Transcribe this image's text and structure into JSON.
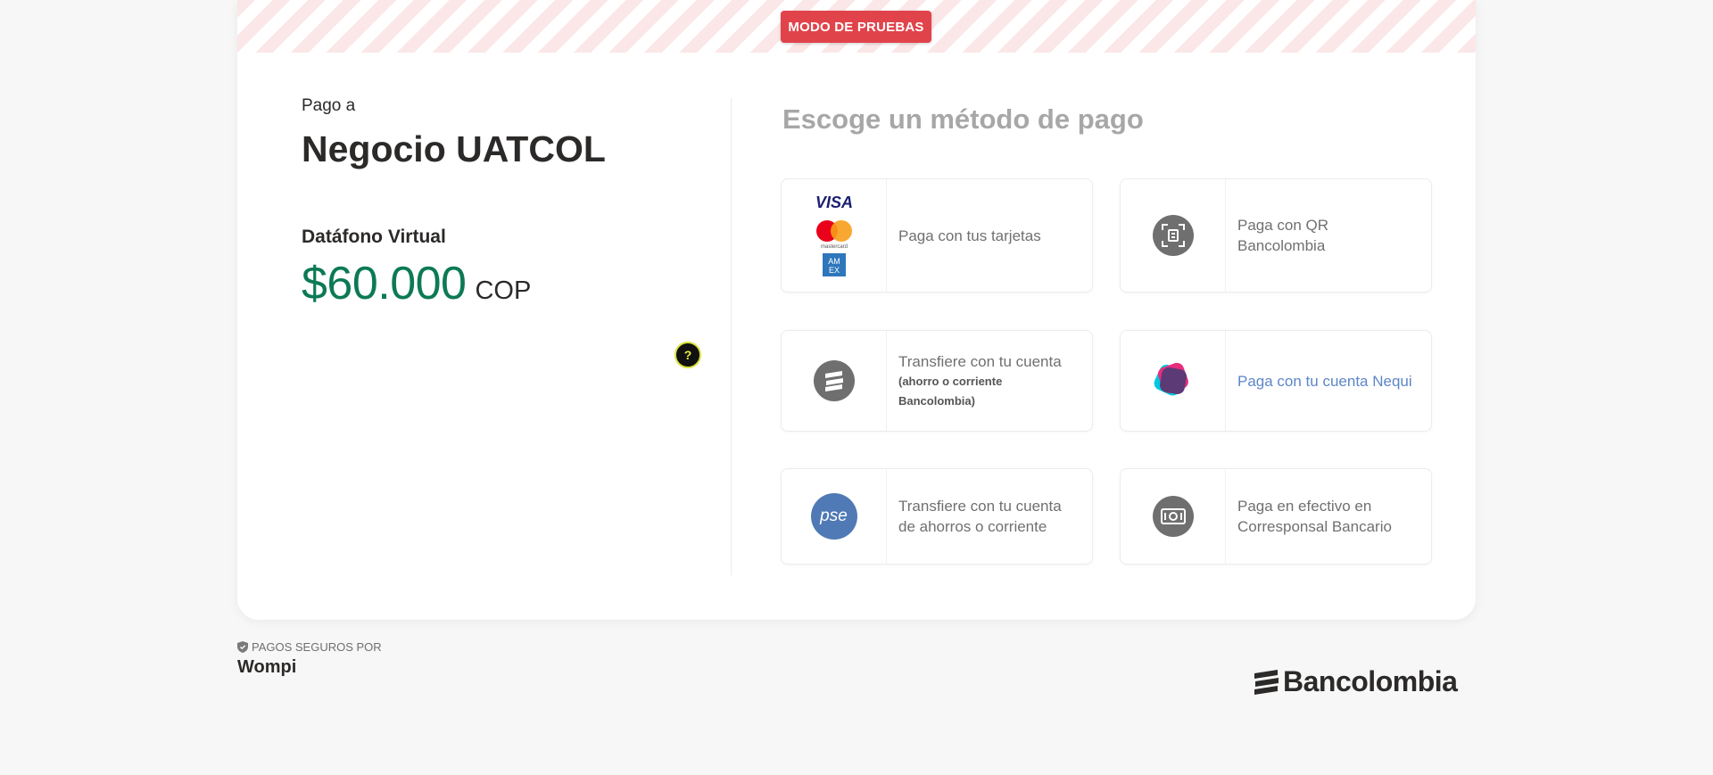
{
  "banner": {
    "label": "MODO DE PRUEBAS",
    "color": "#e1434b"
  },
  "merchant": {
    "pay_to_label": "Pago a",
    "name": "Negocio UATCOL",
    "product": "Datáfono Virtual",
    "amount": "$60.000",
    "currency": "COP",
    "amount_color": "#0c7a55"
  },
  "help": {
    "label": "?",
    "icon": "question-icon"
  },
  "methods": {
    "title": "Escoge un método de pago",
    "options": [
      {
        "label": "Paga con tus tarjetas",
        "icon": "card-brands-icon",
        "brands": {
          "visa": "VISA",
          "mastercard": "mastercard",
          "amex_line1": "AM",
          "amex_line2": "EX"
        }
      },
      {
        "label": "Paga con QR Bancolombia",
        "icon": "qr-scan-icon"
      },
      {
        "label": "Transfiere con tu cuenta",
        "sublabel": "(ahorro o corriente Bancolombia)",
        "icon": "bancolombia-transfer-icon"
      },
      {
        "label": "Paga con tu cuenta Nequi",
        "icon": "nequi-icon"
      },
      {
        "label": "Transfiere con tu cuenta de ahorros o corriente",
        "icon": "pse-icon",
        "icon_text": "pse"
      },
      {
        "label": "Paga en efectivo en Corresponsal Bancario",
        "icon": "cash-icon"
      }
    ]
  },
  "footer": {
    "secure_label": "PAGOS SEGUROS POR",
    "brand": "Wompi",
    "partner": "Bancolombia"
  }
}
